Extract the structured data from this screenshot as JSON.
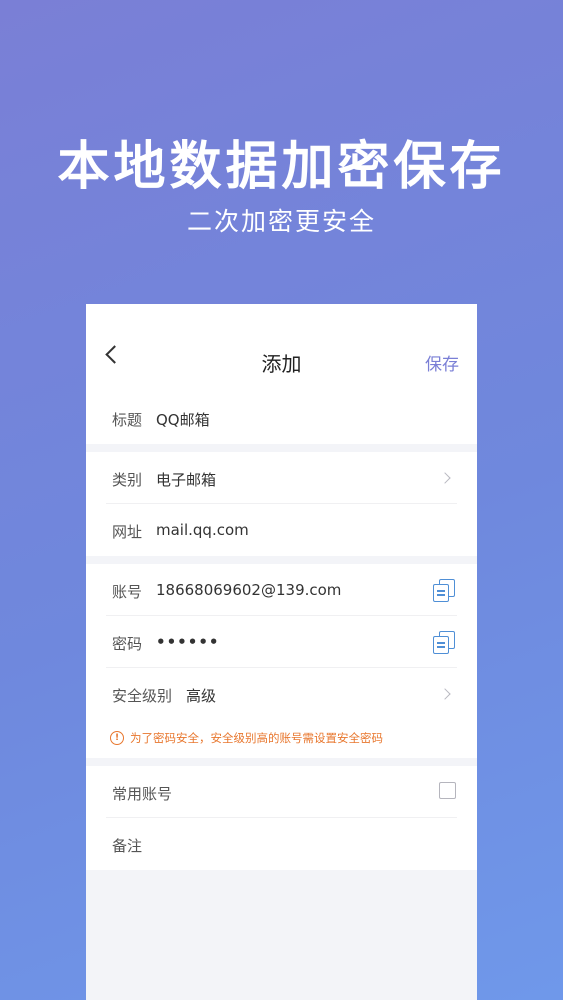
{
  "hero": {
    "title": "本地数据加密保存",
    "subtitle": "二次加密更安全"
  },
  "nav": {
    "title": "添加",
    "save_label": "保存"
  },
  "form": {
    "title": {
      "label": "标题",
      "value": "QQ邮箱"
    },
    "category": {
      "label": "类别",
      "value": "电子邮箱"
    },
    "url": {
      "label": "网址",
      "value": "mail.qq.com"
    },
    "account": {
      "label": "账号",
      "value": "18668069602@139.com"
    },
    "password": {
      "label": "密码",
      "value": "••••••"
    },
    "security_level": {
      "label": "安全级别",
      "value": "高级"
    },
    "warning": "为了密码安全，安全级别高的账号需设置安全密码",
    "common_account": {
      "label": "常用账号",
      "checked": false
    },
    "note": {
      "label": "备注",
      "value": ""
    }
  },
  "icons": {
    "back": "chevron-left-icon",
    "chevron": "chevron-right-icon",
    "copy": "copy-icon",
    "warning": "exclamation-circle-icon"
  },
  "colors": {
    "accent": "#7a7fd6",
    "copy_icon": "#4f8fd6",
    "warning": "#e8772e"
  }
}
